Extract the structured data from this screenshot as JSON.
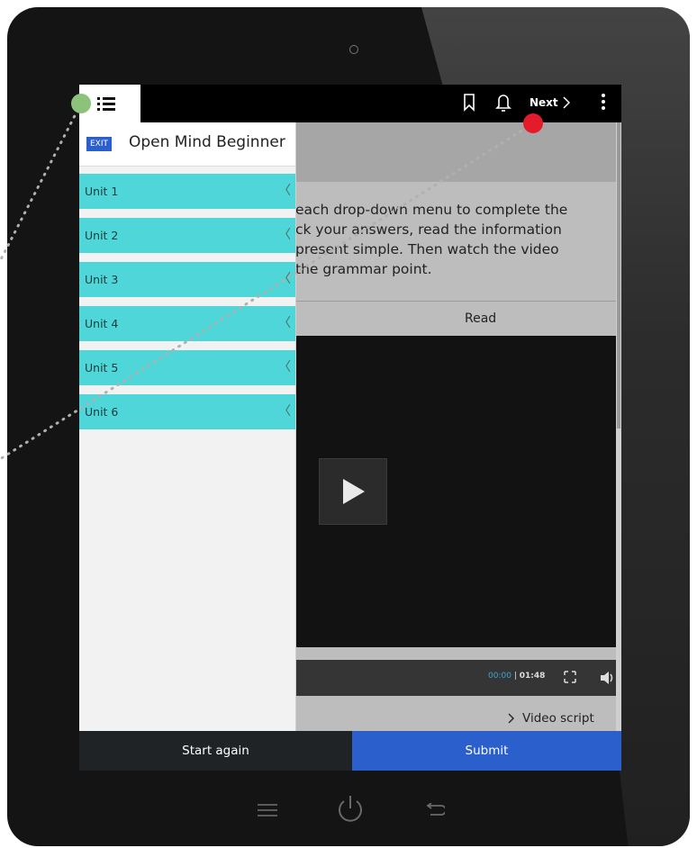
{
  "topbar": {
    "menu_icon": "list-icon",
    "bookmark_icon": "bookmark-icon",
    "bell_icon": "bell-icon",
    "next_label": "Next",
    "more_icon": "kebab-icon"
  },
  "sidebar": {
    "exit_label": "EXIT",
    "course_title": "Open Mind Beginner",
    "units": [
      {
        "label": "Unit 1"
      },
      {
        "label": "Unit 2"
      },
      {
        "label": "Unit 3"
      },
      {
        "label": "Unit 4"
      },
      {
        "label": "Unit 5"
      },
      {
        "label": "Unit 6"
      }
    ]
  },
  "main": {
    "instructions": [
      "each drop-down menu to complete the",
      "ck your answers, read the information",
      "present simple. Then watch the video",
      "the grammar point."
    ],
    "read_tab": "Read",
    "video": {
      "current_time": "00:00",
      "separator": "|",
      "duration": "01:48"
    },
    "video_script_label": "Video script"
  },
  "footer": {
    "start_again": "Start again",
    "submit": "Submit"
  },
  "colors": {
    "accent_blue": "#2b5fcc",
    "unit_cyan": "#4fd6d9",
    "annotation_green": "#8cc27a",
    "annotation_red": "#e41b2b"
  }
}
